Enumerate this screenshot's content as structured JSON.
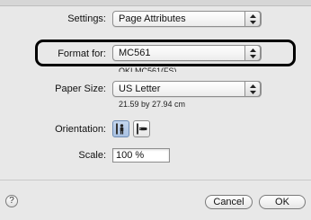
{
  "settings": {
    "label": "Settings:",
    "value": "Page Attributes"
  },
  "format": {
    "label": "Format for:",
    "value": "MC561",
    "subtitle": "OKI MC561(FS)"
  },
  "paper": {
    "label": "Paper Size:",
    "value": "US Letter",
    "dimensions": "21.59 by 27.94 cm"
  },
  "orientation": {
    "label": "Orientation:",
    "options": [
      {
        "name": "portrait",
        "selected": true
      },
      {
        "name": "landscape",
        "selected": false
      }
    ]
  },
  "scale": {
    "label": "Scale:",
    "value": "100 %"
  },
  "footer": {
    "help": "?",
    "cancel": "Cancel",
    "ok": "OK"
  },
  "icons": {
    "help": "help-icon",
    "popup_arrows": "up-down-arrows-icon",
    "orientation": "person-icon"
  }
}
